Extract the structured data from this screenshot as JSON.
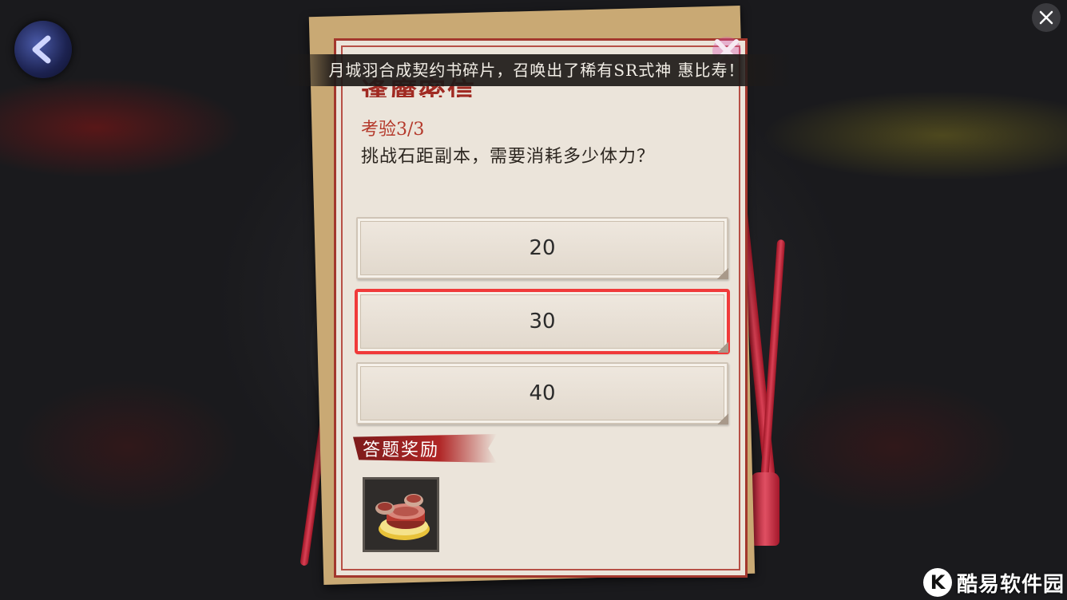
{
  "notice": {
    "text": "月城羽合成契约书碎片，召唤出了稀有SR式神 惠比寿！"
  },
  "panel": {
    "title_partial": "逢魔密信",
    "stage": "考验3/3",
    "question": "挑战石距副本，需要消耗多少体力？",
    "options": [
      {
        "label": "20",
        "selected": false
      },
      {
        "label": "30",
        "selected": true
      },
      {
        "label": "40",
        "selected": false
      }
    ],
    "reward_label": "答题奖励"
  },
  "icons": {
    "back": "back-arrow-icon",
    "close_panel": "close-x-icon",
    "close_corner": "close-icon",
    "reward": "food-dish-icon"
  },
  "watermark": {
    "logo_letter": "K",
    "text": "酷易软件园"
  },
  "colors": {
    "accent_red": "#a3372d",
    "selection_outline": "#f03a3a",
    "paper": "#ebe4da"
  }
}
